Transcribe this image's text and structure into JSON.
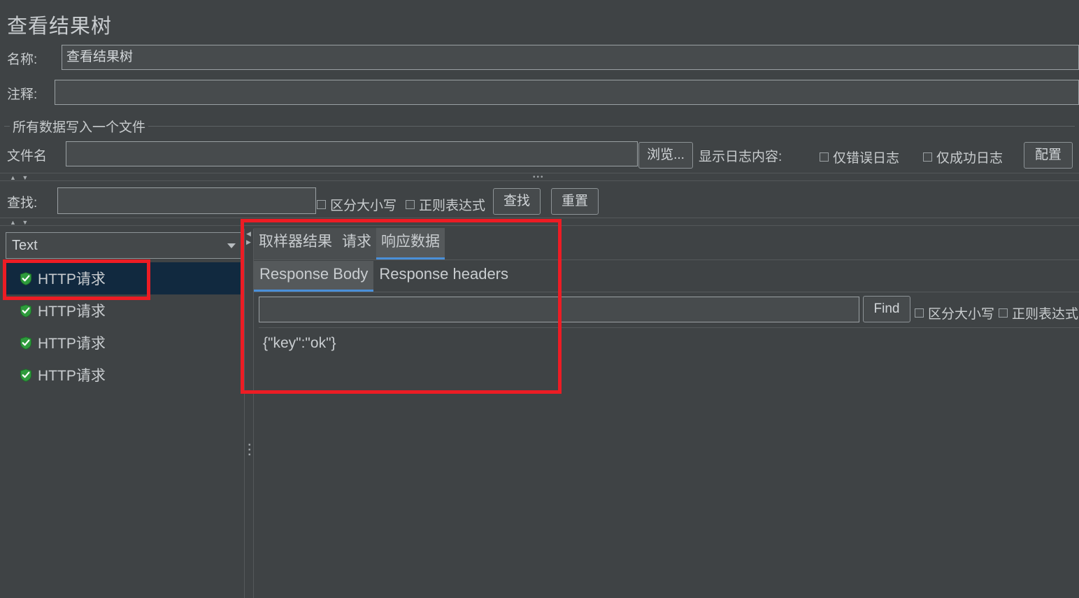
{
  "header": {
    "page_title": "查看结果树",
    "name_label": "名称:",
    "name_value": "查看结果树",
    "comment_label": "注释:",
    "comment_value": ""
  },
  "file_group": {
    "group_title": "所有数据写入一个文件",
    "filename_label": "文件名",
    "filename_value": "",
    "browse_button": "浏览...",
    "log_display_label": "显示日志内容:",
    "errors_only_checkbox": "仅错误日志",
    "successes_only_checkbox": "仅成功日志",
    "configure_button": "配置"
  },
  "search_bar": {
    "find_label": "查找:",
    "find_value": "",
    "case_sensitive_checkbox": "区分大小写",
    "regex_checkbox": "正则表达式",
    "find_button": "查找",
    "reset_button": "重置"
  },
  "tree_panel": {
    "renderer_selected": "Text",
    "items": [
      {
        "label": "HTTP请求",
        "icon": "shield-success-icon",
        "selected": true
      },
      {
        "label": "HTTP请求",
        "icon": "shield-success-icon",
        "selected": false
      },
      {
        "label": "HTTP请求",
        "icon": "shield-success-icon",
        "selected": false
      },
      {
        "label": "HTTP请求",
        "icon": "shield-success-icon",
        "selected": false
      }
    ]
  },
  "result_panel": {
    "tabs": [
      {
        "label": "取样器结果",
        "active": false
      },
      {
        "label": "请求",
        "active": false
      },
      {
        "label": "响应数据",
        "active": true
      }
    ],
    "subtabs": [
      {
        "label": "Response Body",
        "active": true
      },
      {
        "label": "Response headers",
        "active": false
      }
    ],
    "find_value": "",
    "find_button": "Find",
    "case_sensitive_checkbox": "区分大小写",
    "regex_checkbox": "正则表达式",
    "response_body": "{\"key\":\"ok\"}"
  },
  "splitters": {
    "collapse_arrows": "▲ ▼",
    "handle_dots": "•••",
    "vertical_arrows_up": "◀",
    "vertical_arrows_down": "▶",
    "vertical_dots": "▪▪▪"
  },
  "colors": {
    "background": "#3f4345",
    "field_background": "#474b4d",
    "border": "#9aa0a3",
    "selection": "#11293f",
    "accent_tab_underline": "#4a90d9",
    "annotation_red": "#ed1c24",
    "shield_green": "#2e9b3c"
  }
}
